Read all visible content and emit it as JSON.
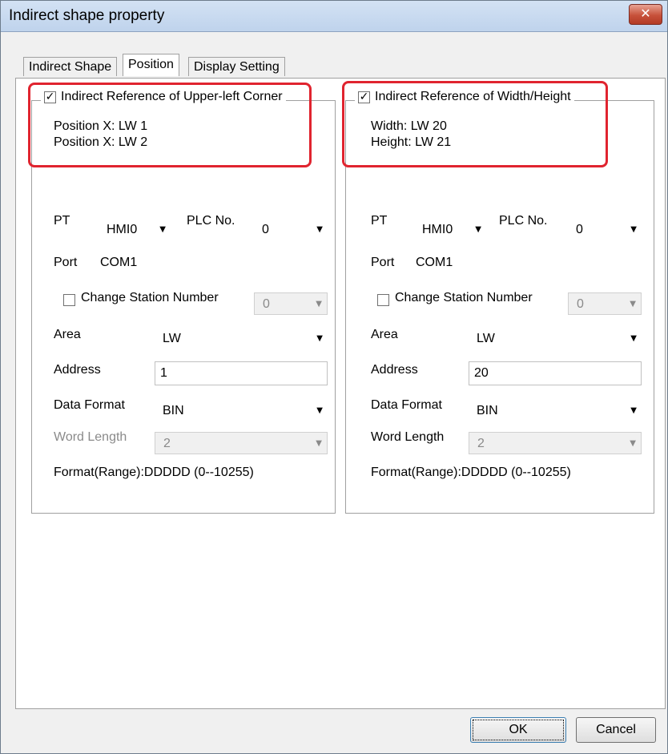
{
  "window": {
    "title": "Indirect shape property",
    "close_glyph": "✕"
  },
  "tabs": [
    {
      "label": "Indirect Shape"
    },
    {
      "label": "Position"
    },
    {
      "label": "Display Setting"
    }
  ],
  "left": {
    "legend": "Indirect Reference of Upper-left Corner",
    "checked": "✓",
    "line1": "Position X: LW 1",
    "line2": "Position X: LW 2",
    "pt_label": "PT",
    "pt_value": "HMI0",
    "plc_label": "PLC No.",
    "plc_value": "0",
    "port_label": "Port",
    "port_value": "COM1",
    "change_station_label": "Change Station Number",
    "station_value": "0",
    "area_label": "Area",
    "area_value": "LW",
    "address_label": "Address",
    "address_value": "1",
    "format_label": "Data Format",
    "format_value": "BIN",
    "word_length_label": "Word Length",
    "word_length_value": "2",
    "range_text": "Format(Range):DDDDD (0--10255)"
  },
  "right": {
    "legend": "Indirect Reference of Width/Height",
    "checked": "✓",
    "line1": "Width: LW 20",
    "line2": "Height: LW 21",
    "pt_label": "PT",
    "pt_value": "HMI0",
    "plc_label": "PLC No.",
    "plc_value": "0",
    "port_label": "Port",
    "port_value": "COM1",
    "change_station_label": "Change Station Number",
    "station_value": "0",
    "area_label": "Area",
    "area_value": "LW",
    "address_label": "Address",
    "address_value": "20",
    "format_label": "Data Format",
    "format_value": "BIN",
    "word_length_label": "Word Length",
    "word_length_value": "2",
    "range_text": "Format(Range):DDDDD (0--10255)"
  },
  "buttons": {
    "ok": "OK",
    "cancel": "Cancel"
  },
  "icons": {
    "dropdown_arrow": "▼"
  },
  "colors": {
    "highlight": "#e0242f"
  }
}
